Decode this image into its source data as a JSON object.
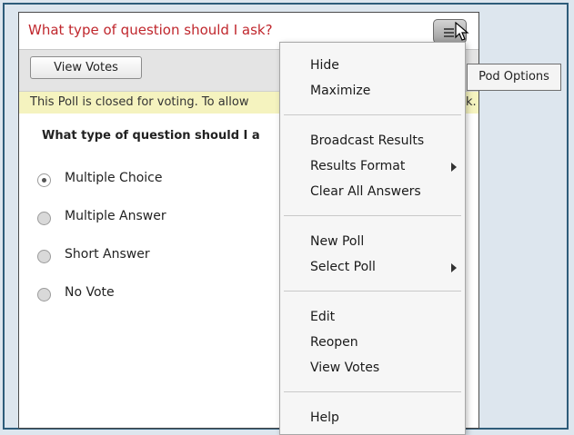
{
  "pod": {
    "title": "What type of question should I ask?",
    "options_icon": "hamburger-menu-icon",
    "view_votes_label": "View Votes",
    "notice_text": "This Poll is closed for voting. To allow",
    "question": "What type of question should I a",
    "answers": [
      {
        "label": "Multiple Choice",
        "selected": true
      },
      {
        "label": "Multiple Answer",
        "selected": false
      },
      {
        "label": "Short Answer",
        "selected": false
      },
      {
        "label": "No Vote",
        "selected": false
      }
    ]
  },
  "menu": {
    "hide": "Hide",
    "maximize": "Maximize",
    "broadcast_results": "Broadcast Results",
    "results_format": "Results Format",
    "clear_all_answers": "Clear All Answers",
    "new_poll": "New Poll",
    "select_poll": "Select Poll",
    "edit": "Edit",
    "reopen": "Reopen",
    "view_votes": "View Votes",
    "help": "Help"
  },
  "tooltip": "Pod Options",
  "notice_tail": "k.",
  "colors": {
    "title_red": "#c0272d",
    "notice_bg": "#f5f3bf",
    "frame_border": "#2e5c7a"
  }
}
